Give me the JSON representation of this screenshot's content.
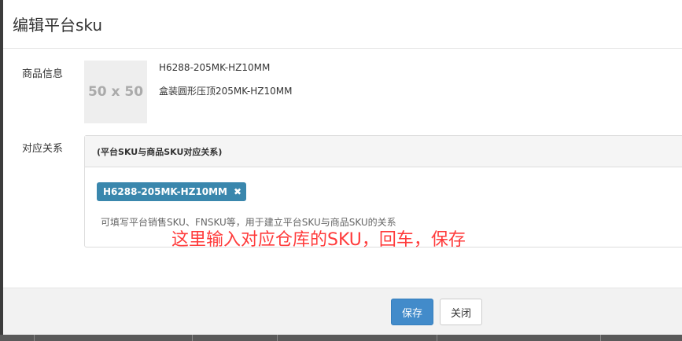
{
  "modal": {
    "title": "编辑平台sku"
  },
  "product_info": {
    "label": "商品信息",
    "image_placeholder": "50 x 50",
    "sku": "H6288-205MK-HZ10MM",
    "name": "盒装圆形压顶205MK-HZ10MM"
  },
  "mapping": {
    "label": "对应关系",
    "panel_title": "(平台SKU与商品SKU对应关系)",
    "tags": [
      "H6288-205MK-HZ10MM"
    ],
    "help_text": "可填写平台销售SKU、FNSKU等，用于建立平台SKU与商品SKU的关系"
  },
  "annotation": {
    "text": "这里输入对应仓库的SKU，回车，保存",
    "color": "#ff3b3b"
  },
  "footer": {
    "save_label": "保存",
    "close_label": "关闭"
  },
  "colors": {
    "primary": "#428bca",
    "tag": "#3a87ad"
  }
}
